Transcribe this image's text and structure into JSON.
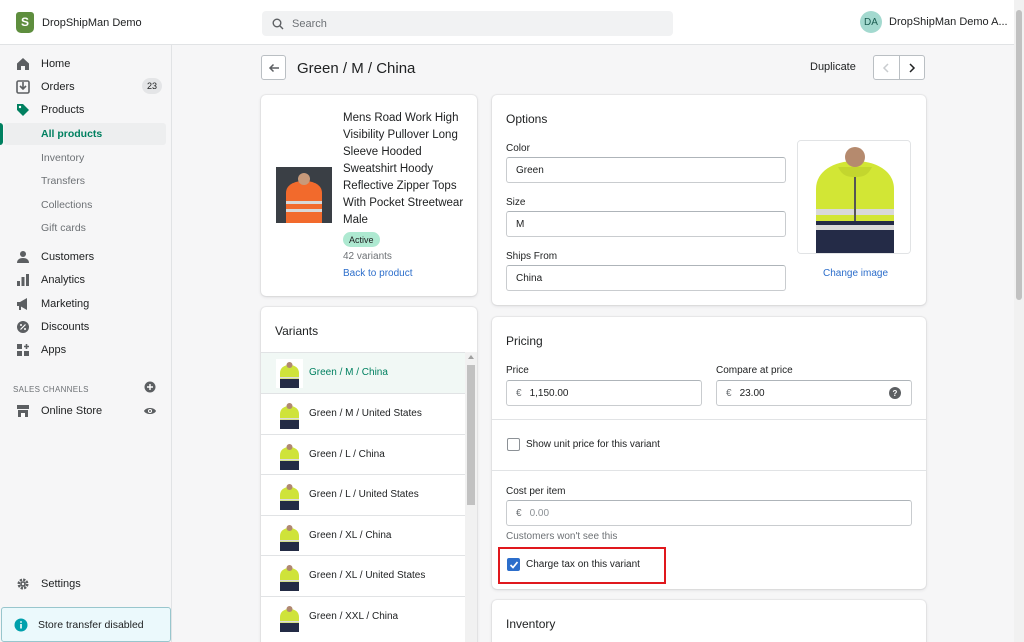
{
  "app": {
    "store_name": "DropShipMan Demo",
    "user_initials": "DA",
    "user_name": "DropShipMan Demo A..."
  },
  "search": {
    "placeholder": "Search"
  },
  "sidebar": {
    "items": [
      {
        "label": "Home",
        "icon": "home-icon"
      },
      {
        "label": "Orders",
        "icon": "orders-icon",
        "count": "23"
      },
      {
        "label": "Products",
        "icon": "tag-icon"
      },
      {
        "label": "Customers",
        "icon": "person-icon"
      },
      {
        "label": "Analytics",
        "icon": "bar-chart-icon"
      },
      {
        "label": "Marketing",
        "icon": "megaphone-icon"
      },
      {
        "label": "Discounts",
        "icon": "discount-icon"
      },
      {
        "label": "Apps",
        "icon": "apps-icon"
      }
    ],
    "product_sub": [
      "All products",
      "Inventory",
      "Transfers",
      "Collections",
      "Gift cards"
    ],
    "sales_channels_label": "SALES CHANNELS",
    "online_store": "Online Store",
    "settings": "Settings",
    "store_transfer": "Store transfer disabled"
  },
  "header": {
    "title": "Green / M / China",
    "duplicate": "Duplicate"
  },
  "product": {
    "name": "Mens Road Work High Visibility Pullover Long Sleeve Hooded Sweatshirt Hoody Reflective Zipper Tops With Pocket Streetwear Male",
    "status": "Active",
    "variants_count": "42 variants",
    "back_link": "Back to product"
  },
  "variants": {
    "title": "Variants",
    "items": [
      "Green / M / China",
      "Green / M / United States",
      "Green / L / China",
      "Green / L / United States",
      "Green / XL / China",
      "Green / XL / United States",
      "Green / XXL / China"
    ]
  },
  "options": {
    "title": "Options",
    "color_label": "Color",
    "color_value": "Green",
    "size_label": "Size",
    "size_value": "M",
    "ships_label": "Ships From",
    "ships_value": "China",
    "change_image": "Change image"
  },
  "pricing": {
    "title": "Pricing",
    "price_label": "Price",
    "currency": "€",
    "price_value": "1,150.00",
    "compare_label": "Compare at price",
    "compare_value": "23.00",
    "unit_price_label": "Show unit price for this variant",
    "unit_price_checked": false,
    "cost_label": "Cost per item",
    "cost_value": "0.00",
    "cost_helper": "Customers won't see this",
    "tax_label": "Charge tax on this variant",
    "tax_checked": true
  },
  "inventory": {
    "title": "Inventory"
  },
  "colors": {
    "accent": "#008060",
    "link": "#2c6ecb",
    "highlight": "#e0181d",
    "badge": "#aee9d1"
  }
}
